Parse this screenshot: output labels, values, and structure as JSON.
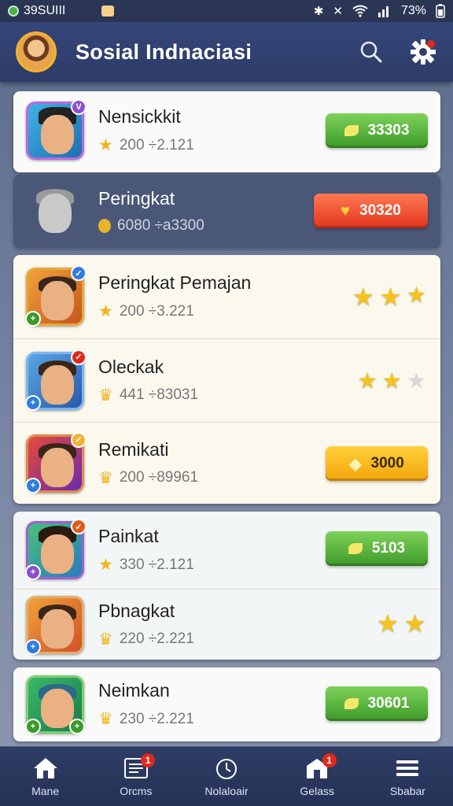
{
  "status_bar": {
    "left_text": "39SUIII",
    "battery": "73%"
  },
  "app": {
    "title": "Sosial Indnaciasi"
  },
  "players": [
    {
      "name": "Nensickkit",
      "stats": "200 ÷2.121",
      "button": "33303",
      "button_color": "green"
    },
    {
      "name": "Peringkat",
      "stats": "6080 ÷a3300",
      "button": "30320",
      "button_color": "red"
    },
    {
      "name": "Peringkat Pemajan",
      "stats": "200 ÷3.221",
      "stars_filled": 3,
      "stars_total": 3
    },
    {
      "name": "Oleckak",
      "stats": "441 ÷83031",
      "stars_filled": 2,
      "stars_total": 3
    },
    {
      "name": "Remikati",
      "stats": "200 ÷89961",
      "button": "3000",
      "button_color": "orange"
    },
    {
      "name": "Painkat",
      "stats": "330 ÷2.121",
      "button": "5103",
      "button_color": "green"
    },
    {
      "name": "Pbnagkat",
      "stats": "220 ÷2.221",
      "stars_filled": 2,
      "stars_total": 2
    },
    {
      "name": "Neimkan",
      "stats": "230 ÷2.221",
      "button": "30601",
      "button_color": "green"
    }
  ],
  "nav": [
    {
      "label": "Mane",
      "icon": "home-icon",
      "badge": ""
    },
    {
      "label": "Orcms",
      "icon": "list-icon",
      "badge": "1"
    },
    {
      "label": "Nolaloair",
      "icon": "timer-icon",
      "badge": ""
    },
    {
      "label": "Gelass",
      "icon": "shop-icon",
      "badge": "1"
    },
    {
      "label": "Sbabar",
      "icon": "menu-icon",
      "badge": ""
    }
  ],
  "colors": {
    "accent": "#2c3b66",
    "green": "#3d9a2a",
    "red": "#e0341c",
    "orange": "#f3a50c",
    "star": "#f6c21c"
  }
}
